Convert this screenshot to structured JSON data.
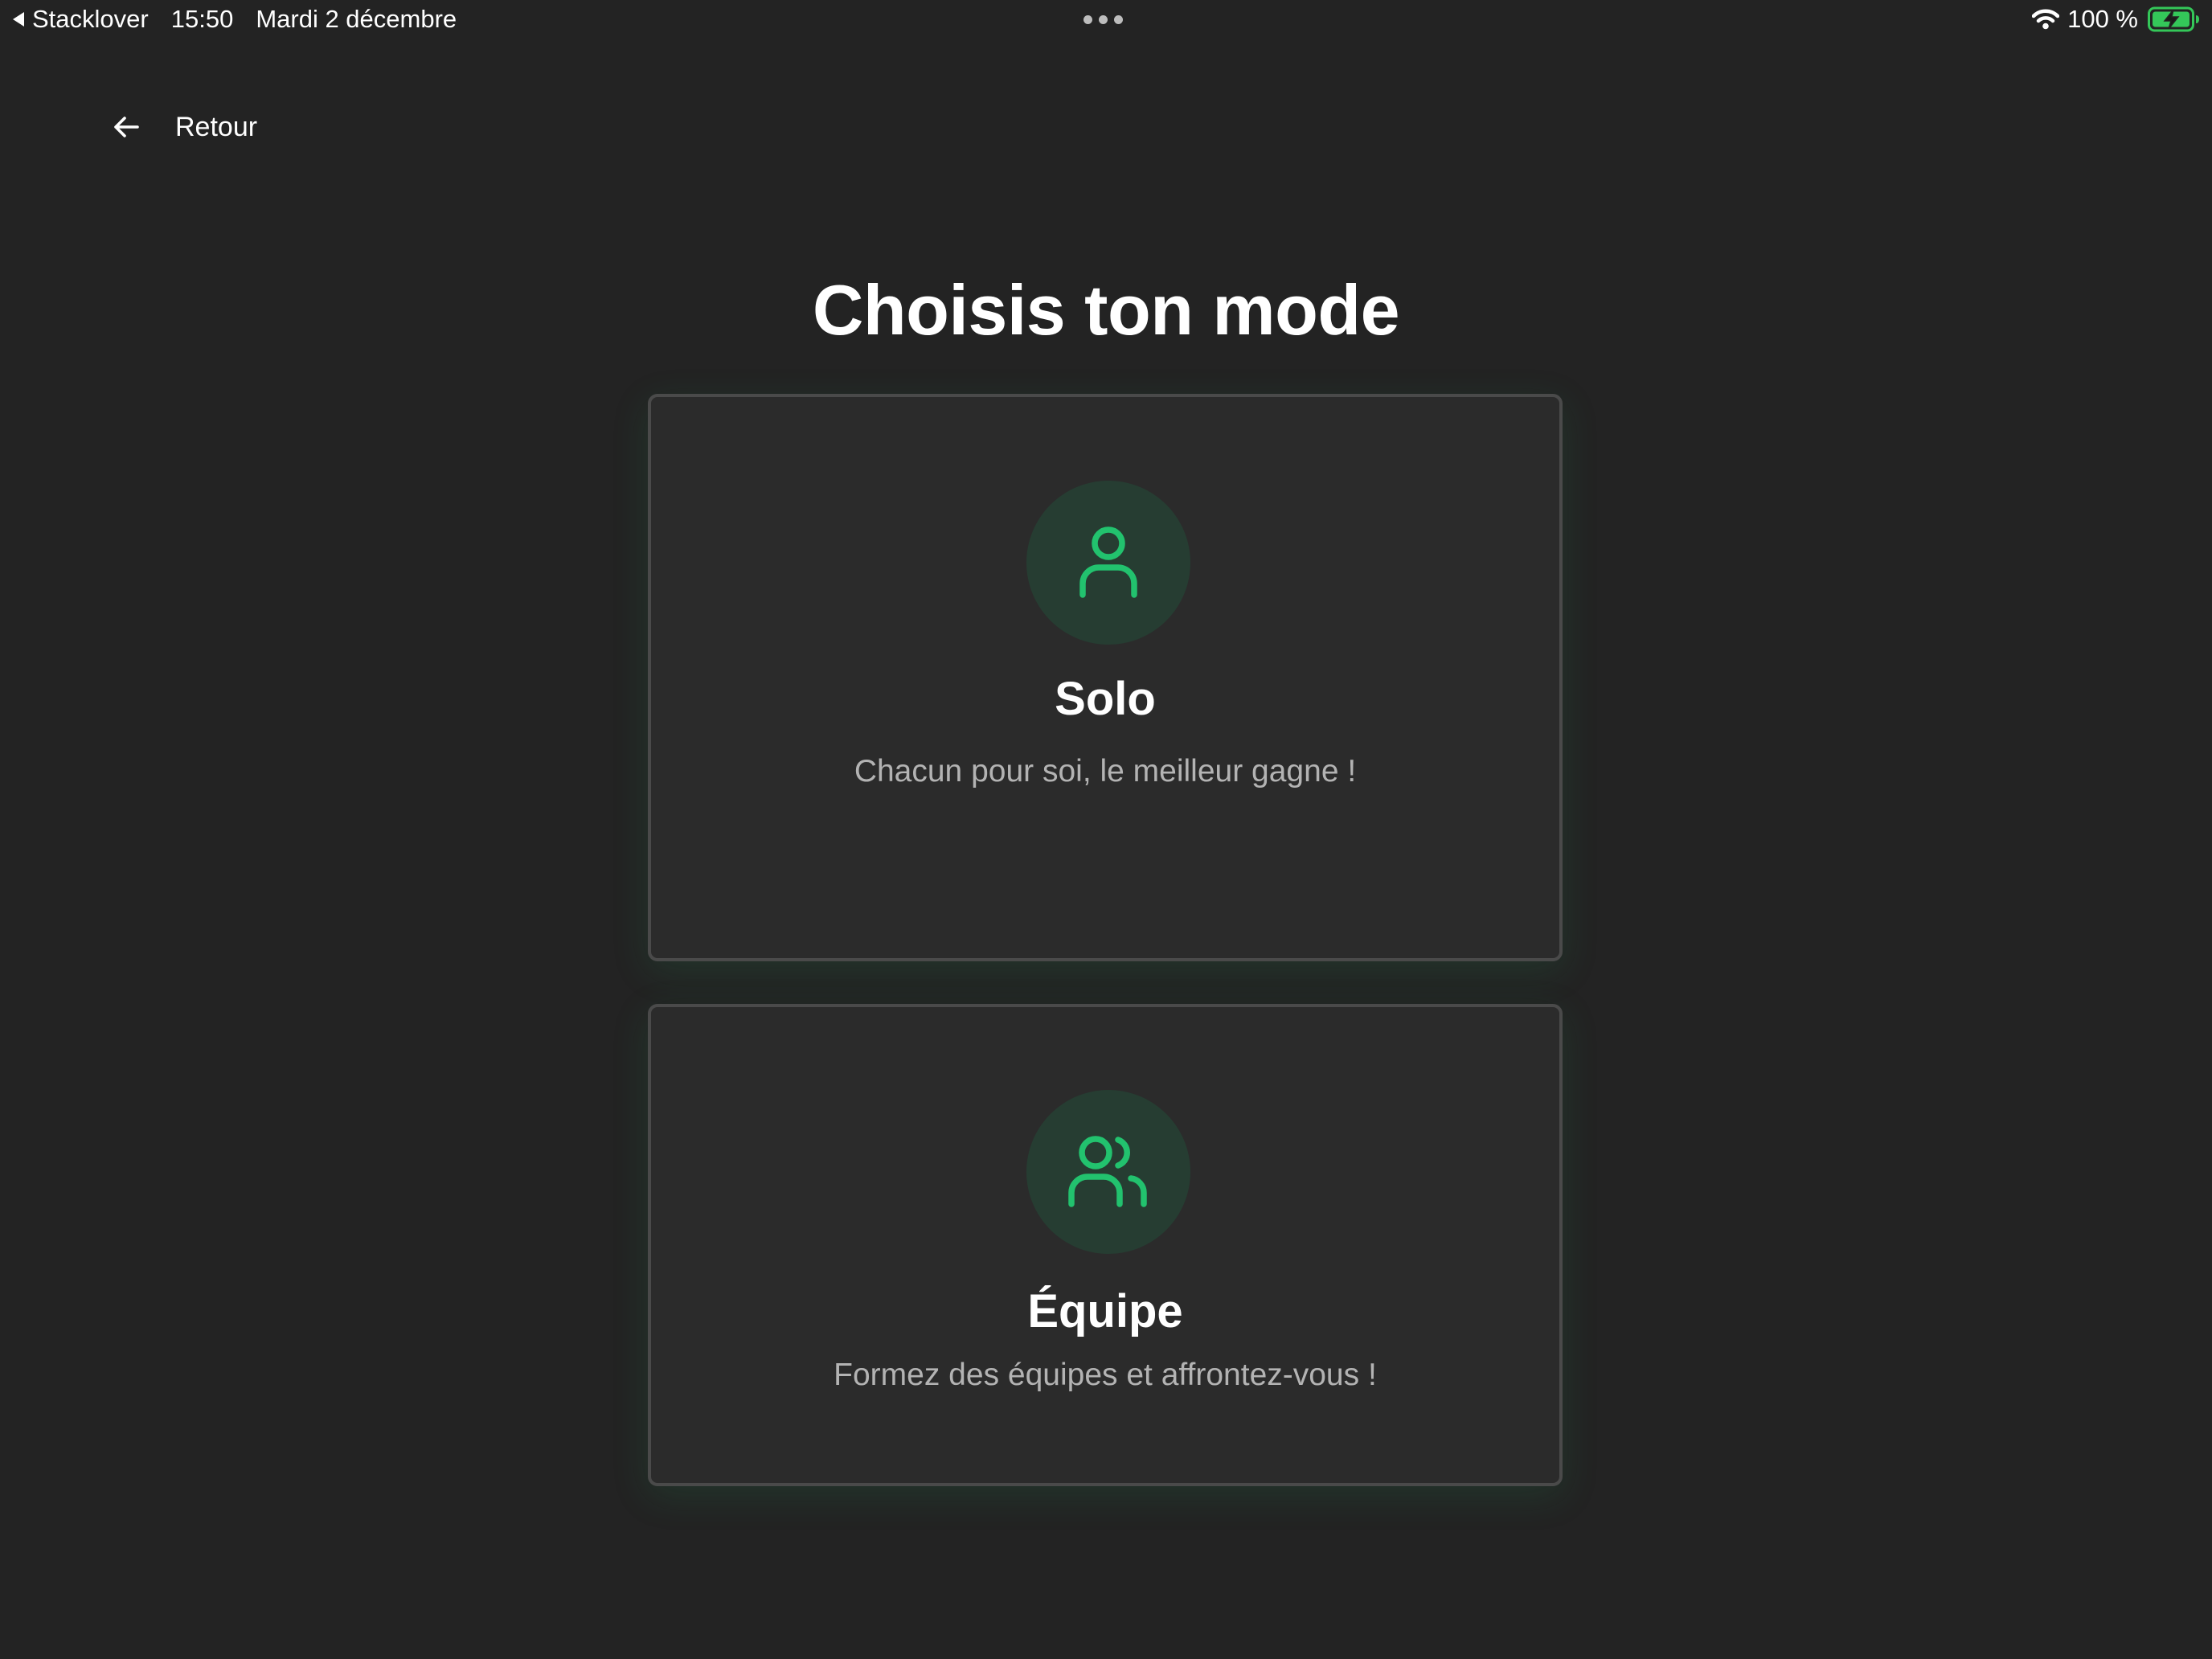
{
  "status_bar": {
    "app_name": "Stacklover",
    "time": "15:50",
    "date": "Mardi 2 décembre",
    "battery": "100 %"
  },
  "nav": {
    "back_label": "Retour"
  },
  "page": {
    "title": "Choisis ton mode"
  },
  "modes": [
    {
      "title": "Solo",
      "description": "Chacun pour soi, le meilleur gagne !",
      "icon": "user-icon"
    },
    {
      "title": "Équipe",
      "description": "Formez des équipes et affrontez-vous !",
      "icon": "users-icon"
    }
  ],
  "colors": {
    "background": "#232323",
    "card_background": "#2b2b2b",
    "card_border": "#4a4a4a",
    "accent_green": "#22c26e",
    "icon_circle": "#263d32",
    "battery_green": "#34c759"
  }
}
